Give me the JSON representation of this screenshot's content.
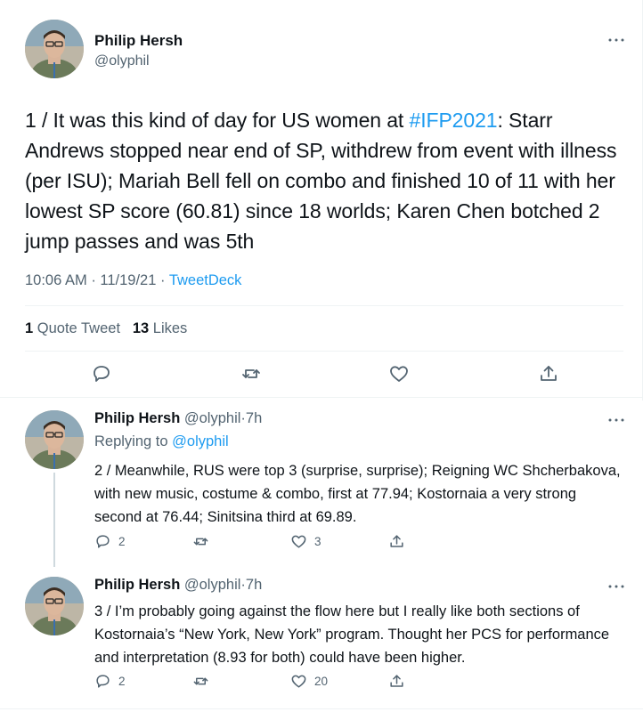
{
  "main_tweet": {
    "author_name": "Philip Hersh",
    "author_handle": "@olyphil",
    "text_before_tag": "1 / It was this kind of day for US women at ",
    "hashtag": "#IFP2021",
    "text_after_tag": ": Starr Andrews stopped near end of SP,  withdrew from event with illness (per ISU); Mariah Bell fell on combo and finished 10 of 11 with her lowest SP score (60.81) since 18 worlds; Karen Chen botched 2 jump passes and was 5th",
    "time": "10:06 AM",
    "date": "11/19/21",
    "source": "TweetDeck",
    "quote_count": "1",
    "quote_label": "Quote Tweet",
    "like_count": "13",
    "like_label": "Likes",
    "icons": [
      "reply-icon",
      "retweet-icon",
      "like-icon",
      "share-icon"
    ]
  },
  "replies": [
    {
      "author_name": "Philip Hersh",
      "author_handle": "@olyphil",
      "age": "7h",
      "replying_label": "Replying to",
      "replying_to": "@olyphil",
      "text": "2 / Meanwhile, RUS were top 3 (surprise, surprise); Reigning WC Shcherbakova, with new music, costume & combo, first at 77.94; Kostornaia a very strong second at 76.44; Sinitsina third at 69.89.",
      "reply_count": "2",
      "retweet_count": "",
      "like_count": "3"
    },
    {
      "author_name": "Philip Hersh",
      "author_handle": "@olyphil",
      "age": "7h",
      "text": "3 / I’m probably going against the flow here but I really like both sections of Kostornaia’s “New York, New York” program.  Thought her PCS for performance and interpretation (8.93 for both) could have been higher.",
      "reply_count": "2",
      "retweet_count": "",
      "like_count": "20"
    }
  ],
  "separator": "·",
  "colors": {
    "text": "#0f1419",
    "secondary": "#536471",
    "accent": "#1d9bf0",
    "border": "#eff3f4"
  }
}
